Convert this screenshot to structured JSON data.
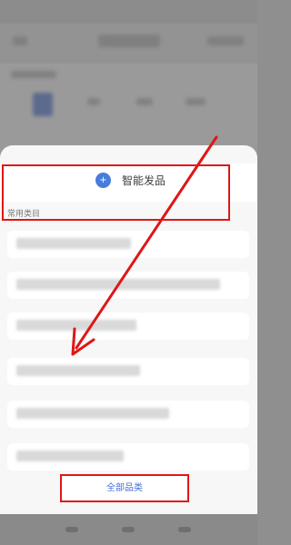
{
  "sheet": {
    "smart_publish_label": "智能发品",
    "common_categories_label": "常用类目",
    "all_categories_label": "全部品类"
  },
  "list_items": [
    {
      "label": ""
    },
    {
      "label": ""
    },
    {
      "label": ""
    },
    {
      "label": ""
    },
    {
      "label": ""
    },
    {
      "label": ""
    }
  ],
  "colors": {
    "accent": "#2a5bd3",
    "annotation": "#e01616"
  },
  "icons": {
    "smart_publish": "doc-plus-icon"
  }
}
